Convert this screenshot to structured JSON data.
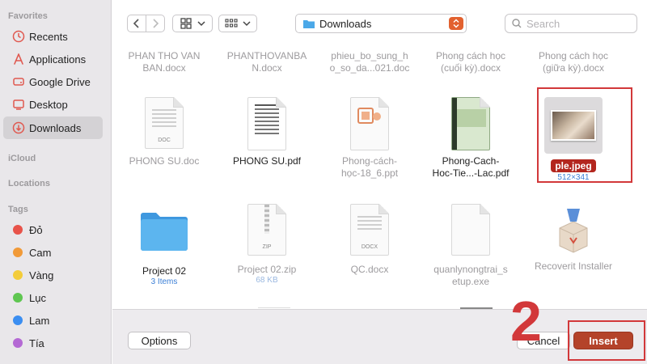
{
  "sidebar": {
    "favorites_label": "Favorites",
    "favorites": [
      {
        "label": "Recents",
        "icon": "clock-icon"
      },
      {
        "label": "Applications",
        "icon": "applications-icon"
      },
      {
        "label": "Google Drive",
        "icon": "drive-icon"
      },
      {
        "label": "Desktop",
        "icon": "desktop-icon"
      },
      {
        "label": "Downloads",
        "icon": "downloads-icon",
        "active": true
      }
    ],
    "icloud_label": "iCloud",
    "locations_label": "Locations",
    "tags_label": "Tags",
    "tags": [
      {
        "label": "Đỏ",
        "color": "#e8534a"
      },
      {
        "label": "Cam",
        "color": "#f19a38"
      },
      {
        "label": "Vàng",
        "color": "#f3cc3a"
      },
      {
        "label": "Lục",
        "color": "#5fc651"
      },
      {
        "label": "Lam",
        "color": "#3b8ef1"
      },
      {
        "label": "Tía",
        "color": "#b469d4"
      }
    ]
  },
  "toolbar": {
    "location": "Downloads",
    "search_placeholder": "Search"
  },
  "files": {
    "row0": [
      {
        "name1": "PHAN THO VAN",
        "name2": "BAN.docx"
      },
      {
        "name1": "PHANTHOVANBA",
        "name2": "N.docx"
      },
      {
        "name1": "phieu_bo_sung_h",
        "name2": "o_so_da...021.doc"
      },
      {
        "name1": "Phong cách học",
        "name2": "(cuối kỳ).docx"
      },
      {
        "name1": "Phong cách học",
        "name2": "(giữa kỳ).docx"
      }
    ],
    "row1": [
      {
        "name1": "PHONG SU.doc",
        "name2": "",
        "doc_label": "DOC"
      },
      {
        "name1": "PHONG SU.pdf",
        "name2": ""
      },
      {
        "name1": "Phong-cách-",
        "name2": "học-18_6.ppt"
      },
      {
        "name1": "Phong-Cach-",
        "name2": "Hoc-Tie...-Lac.pdf"
      },
      {
        "name1": "ple.jpeg",
        "sub": "512×341"
      }
    ],
    "row2": [
      {
        "name1": "Project 02",
        "sub": "3 Items"
      },
      {
        "name1": "Project 02.zip",
        "sub": "68 KB",
        "doc_label": "ZIP"
      },
      {
        "name1": "QC.docx",
        "doc_label": "DOCX"
      },
      {
        "name1": "quanlynongtrai_s",
        "name2": "etup.exe"
      },
      {
        "name1": "Recoverit Installer"
      }
    ]
  },
  "bottom": {
    "options_label": "Options",
    "cancel_label": "Cancel",
    "insert_label": "Insert",
    "step_number": "2"
  },
  "colors": {
    "accent": "#b4432a",
    "highlight": "#d2383a",
    "folder": "#4ba8e8"
  }
}
